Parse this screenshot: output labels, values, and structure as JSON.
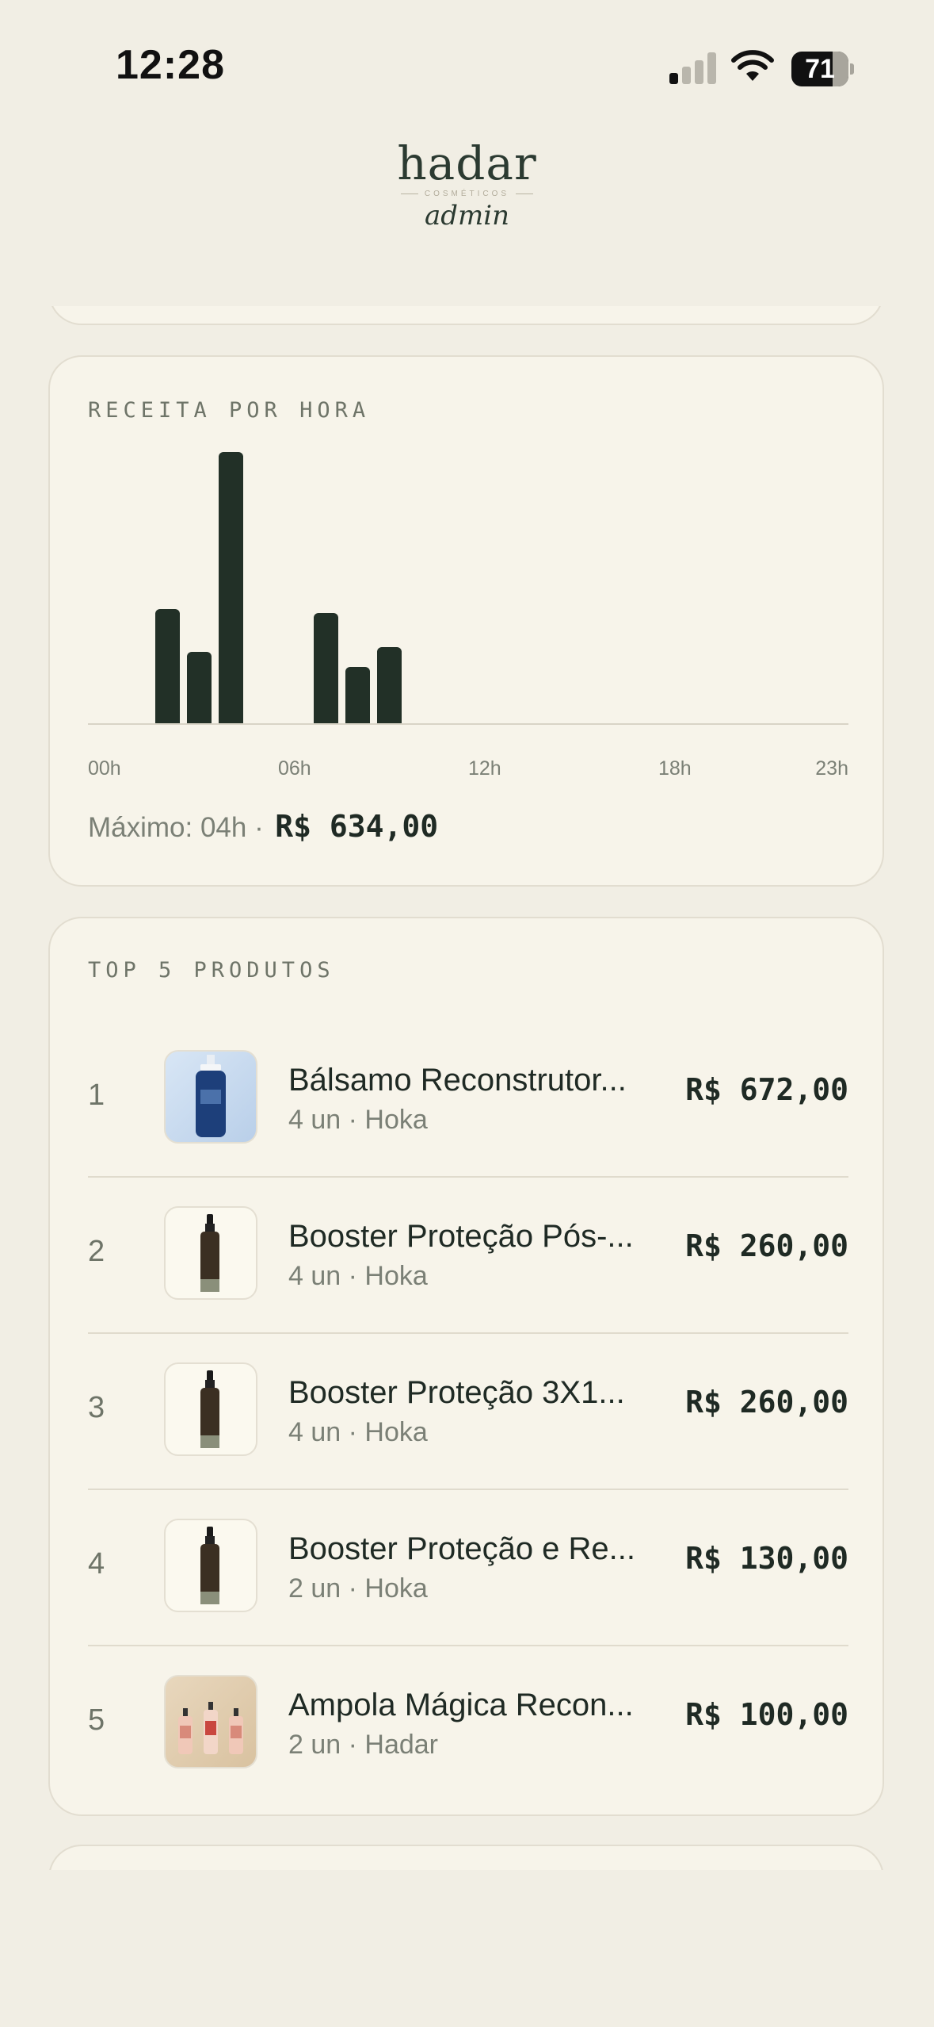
{
  "status_bar": {
    "time": "12:28",
    "battery": "71",
    "signal_bars_active": 1
  },
  "header": {
    "brand": "hadar",
    "brand_sub": "COSMÉTICOS",
    "role": "admin"
  },
  "revenue_card": {
    "title": "RECEITA POR HORA",
    "x_tick_labels": [
      "00h",
      "06h",
      "12h",
      "18h",
      "23h"
    ],
    "max_label": "Máximo: 04h ·",
    "max_value": "R$ 634,00"
  },
  "chart_data": {
    "type": "bar",
    "title": "RECEITA POR HORA",
    "categories": [
      "00h",
      "01h",
      "02h",
      "03h",
      "04h",
      "05h",
      "06h",
      "07h",
      "08h",
      "09h",
      "10h",
      "11h",
      "12h",
      "13h",
      "14h",
      "15h",
      "16h",
      "17h",
      "18h",
      "19h",
      "20h",
      "21h",
      "22h",
      "23h"
    ],
    "values": [
      0,
      0,
      267,
      167,
      634,
      0,
      0,
      258,
      131,
      178,
      0,
      0,
      0,
      0,
      0,
      0,
      0,
      0,
      0,
      0,
      0,
      0,
      0,
      0
    ],
    "ylim": [
      0,
      634
    ]
  },
  "top_products": {
    "title": "TOP 5 PRODUTOS",
    "items": [
      {
        "rank": "1",
        "name": "Bálsamo Reconstrutor...",
        "meta": "4 un · Hoka",
        "price": "R$ 672,00",
        "thumb": "blue-bottle"
      },
      {
        "rank": "2",
        "name": "Booster Proteção Pós-...",
        "meta": "4 un · Hoka",
        "price": "R$ 260,00",
        "thumb": "dark-pump-bottle"
      },
      {
        "rank": "3",
        "name": "Booster Proteção 3X1...",
        "meta": "4 un · Hoka",
        "price": "R$ 260,00",
        "thumb": "dark-pump-bottle"
      },
      {
        "rank": "4",
        "name": "Booster Proteção e Re...",
        "meta": "2 un · Hoka",
        "price": "R$ 130,00",
        "thumb": "dark-pump-bottle"
      },
      {
        "rank": "5",
        "name": "Ampola Mágica Recon...",
        "meta": "2 un · Hadar",
        "price": "R$ 100,00",
        "thumb": "three-ampoules"
      }
    ]
  },
  "colors": {
    "background": "#f1eee4",
    "card": "#f7f4ea",
    "bar": "#223027",
    "muted_text": "#7b8076"
  }
}
